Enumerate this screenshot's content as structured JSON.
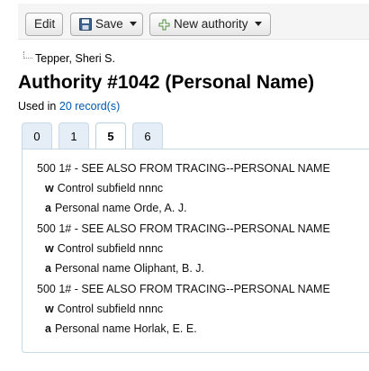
{
  "toolbar": {
    "edit_label": "Edit",
    "save_label": "Save",
    "new_authority_label": "New authority"
  },
  "breadcrumb": {
    "label": "Tepper, Sheri S."
  },
  "header": {
    "title": "Authority #1042 (Personal Name)",
    "used_prefix": "Used in",
    "used_link": "20 record(s)"
  },
  "tabs": [
    {
      "label": "0",
      "active": false
    },
    {
      "label": "1",
      "active": false
    },
    {
      "label": "5",
      "active": true
    },
    {
      "label": "6",
      "active": false
    }
  ],
  "fields": [
    {
      "tag_line": "500 1# - SEE ALSO FROM TRACING--PERSONAL NAME",
      "subfields": [
        {
          "code": "w",
          "text": "Control subfield nnnc"
        },
        {
          "code": "a",
          "text": "Personal name Orde, A. J."
        }
      ]
    },
    {
      "tag_line": "500 1# - SEE ALSO FROM TRACING--PERSONAL NAME",
      "subfields": [
        {
          "code": "w",
          "text": "Control subfield nnnc"
        },
        {
          "code": "a",
          "text": "Personal name Oliphant, B. J."
        }
      ]
    },
    {
      "tag_line": "500 1# - SEE ALSO FROM TRACING--PERSONAL NAME",
      "subfields": [
        {
          "code": "w",
          "text": "Control subfield nnnc"
        },
        {
          "code": "a",
          "text": "Personal name Horlak, E. E."
        }
      ]
    }
  ],
  "colors": {
    "link": "#0059b3",
    "tab_bg": "#e5eef6",
    "tab_border": "#c8d9e6"
  },
  "icons": [
    "save-icon",
    "plus-icon",
    "caret-down-icon"
  ]
}
